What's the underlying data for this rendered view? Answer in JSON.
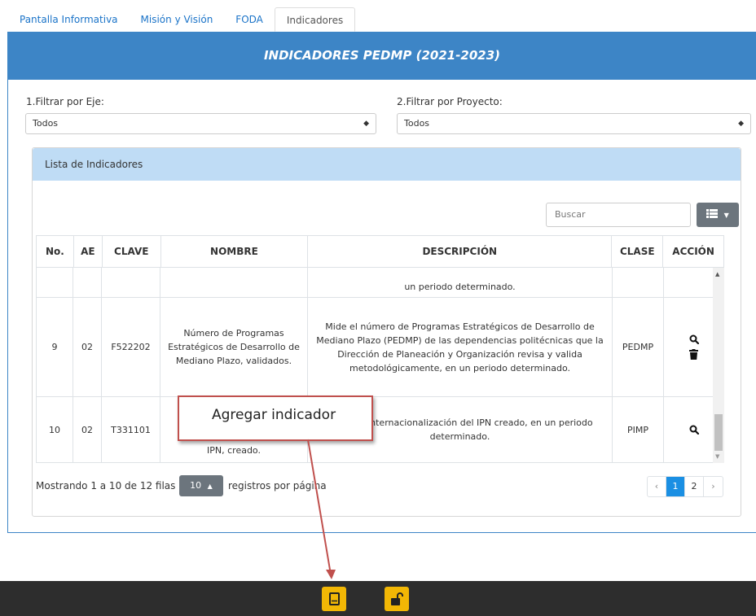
{
  "tabs": [
    {
      "label": "Pantalla Informativa"
    },
    {
      "label": "Misión y Visión"
    },
    {
      "label": "FODA"
    },
    {
      "label": "Indicadores",
      "active": true
    }
  ],
  "panel": {
    "title": "INDICADORES PEDMP (2021-2023)"
  },
  "filters": {
    "eje": {
      "label": "1.Filtrar por Eje:",
      "value": "Todos"
    },
    "proyecto": {
      "label": "2.Filtrar por Proyecto:",
      "value": "Todos"
    }
  },
  "card": {
    "title": "Lista de Indicadores"
  },
  "search": {
    "placeholder": "Buscar"
  },
  "table": {
    "headers": [
      "No.",
      "AE",
      "CLAVE",
      "NOMBRE",
      "DESCRIPCIÓN",
      "CLASE",
      "ACCIÓN"
    ],
    "partial_row": {
      "description": "un periodo determinado."
    },
    "rows": [
      {
        "no": "9",
        "ae": "02",
        "clave": "F522202",
        "nombre": "Número de Programas Estratégicos de Desarrollo de Mediano Plazo, validados.",
        "descripcion": "Mide el número de Programas Estratégicos de Desarrollo de Mediano Plazo (PEDMP) de las dependencias politécnicas que la Dirección de Planeación y Organización revisa y valida metodológicamente, en un periodo determinado.",
        "clase": "PEDMP"
      },
      {
        "no": "10",
        "ae": "02",
        "clave": "T331101",
        "nombre": "IPN, creado.",
        "descripcion": "xto para Internacionalización del IPN creado, en un periodo determinado.",
        "clase": "PIMP"
      }
    ]
  },
  "pagination": {
    "summary": "Mostrando 1 a 10 de 12 filas",
    "per_page": "10",
    "per_page_label": "registros por página",
    "pages": [
      "‹",
      "1",
      "2",
      "›"
    ],
    "current": "1"
  },
  "callout": {
    "text": "Agregar indicador"
  },
  "colors": {
    "primary": "#3d85c6",
    "card_header": "#bfdcf5",
    "accent_yellow": "#f2b705",
    "callout_border": "#c0504d"
  }
}
